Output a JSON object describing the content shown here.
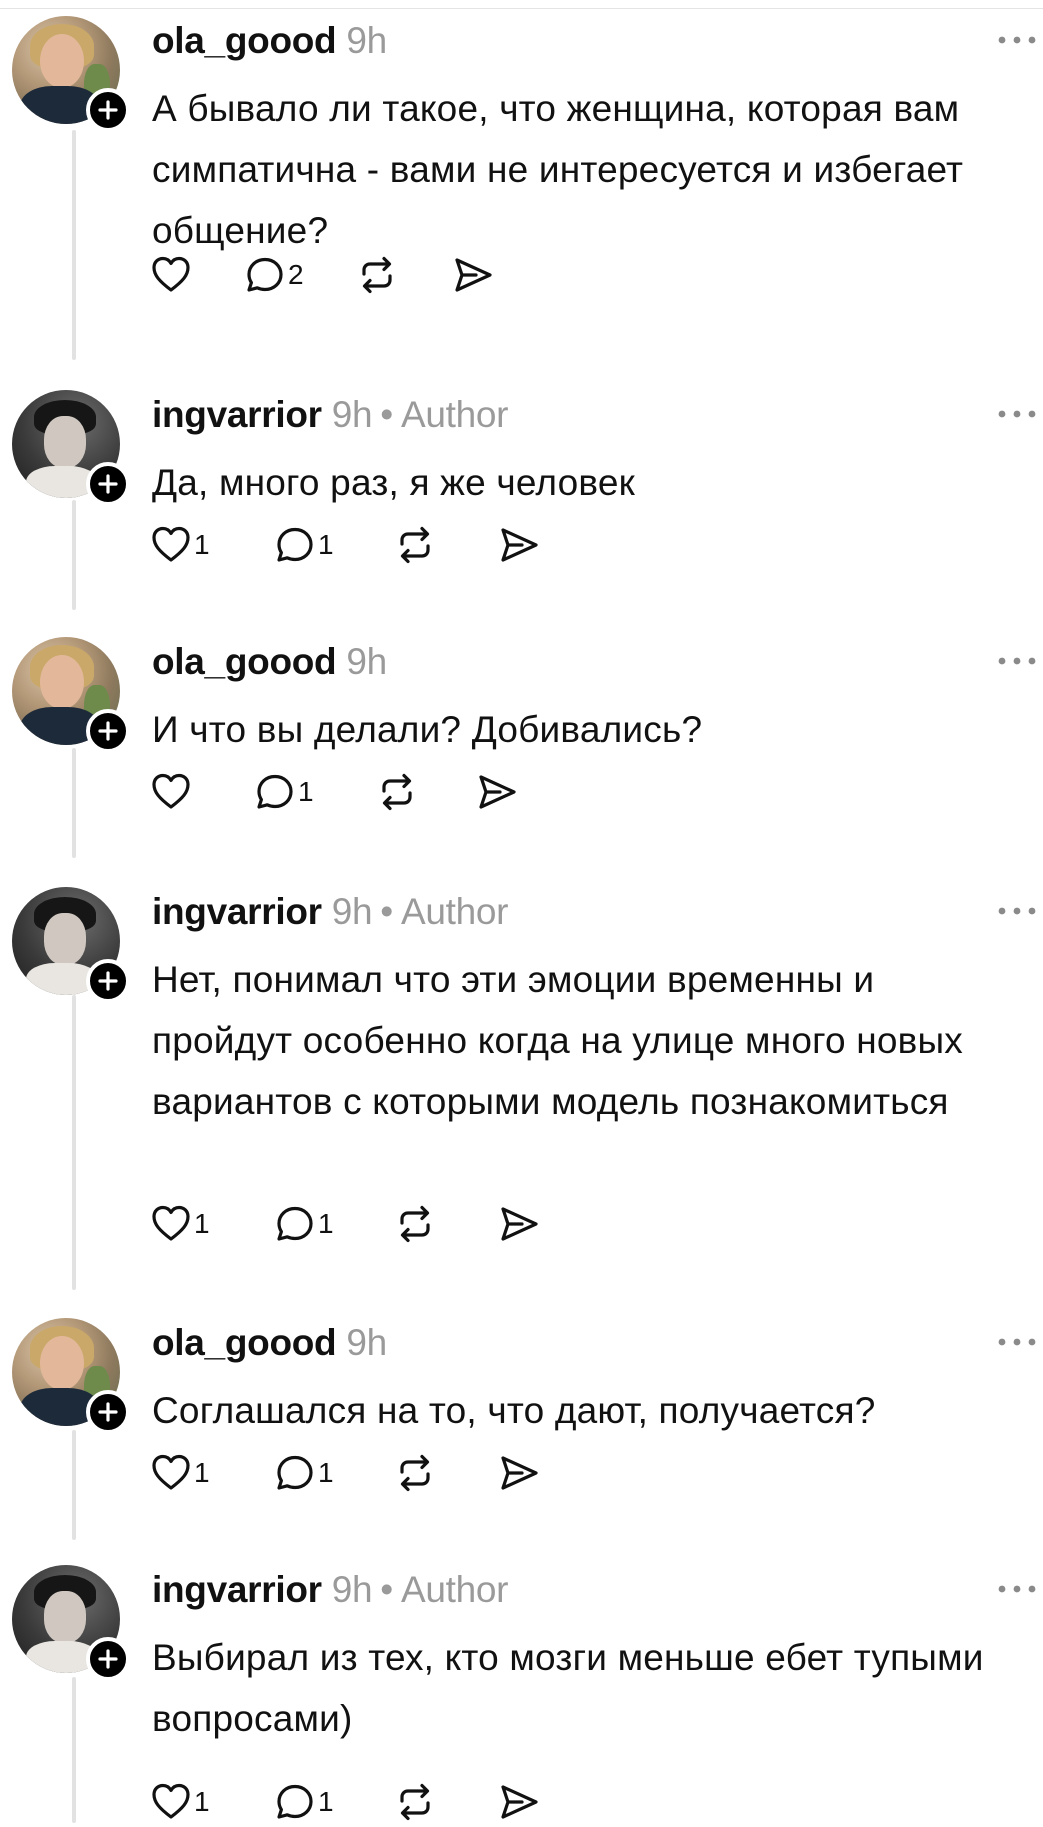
{
  "posts": [
    {
      "username": "ola_goood",
      "time": "9h",
      "author_label": "",
      "text": "А бывало ли такое, что женщина, которая вам симпатична - вами не интересуется и избегает общение?",
      "likes": "",
      "replies": "2",
      "avatar": "female"
    },
    {
      "username": "ingvarrior",
      "time": "9h",
      "author_label": "Author",
      "text": "Да, много раз, я же человек",
      "likes": "1",
      "replies": "1",
      "avatar": "male"
    },
    {
      "username": "ola_goood",
      "time": "9h",
      "author_label": "",
      "text": "И что вы делали? Добивались?",
      "likes": "",
      "replies": "1",
      "avatar": "female"
    },
    {
      "username": "ingvarrior",
      "time": "9h",
      "author_label": "Author",
      "text": "Нет, понимал что эти эмоции временны и пройдут особенно когда на улице много новых вариантов с которыми модель познакомиться",
      "likes": "1",
      "replies": "1",
      "avatar": "male"
    },
    {
      "username": "ola_goood",
      "time": "9h",
      "author_label": "",
      "text": "Соглашался на то, что дают, получается?",
      "likes": "1",
      "replies": "1",
      "avatar": "female"
    },
    {
      "username": "ingvarrior",
      "time": "9h",
      "author_label": "Author",
      "text": "Выбирал из тех, кто мозги меньше ебет тупыми вопросами)",
      "likes": "1",
      "replies": "1",
      "avatar": "male"
    }
  ],
  "icons": {
    "like": "heart-icon",
    "reply": "comment-icon",
    "repost": "repost-icon",
    "share": "send-icon",
    "more": "more-icon",
    "follow": "plus-icon"
  }
}
